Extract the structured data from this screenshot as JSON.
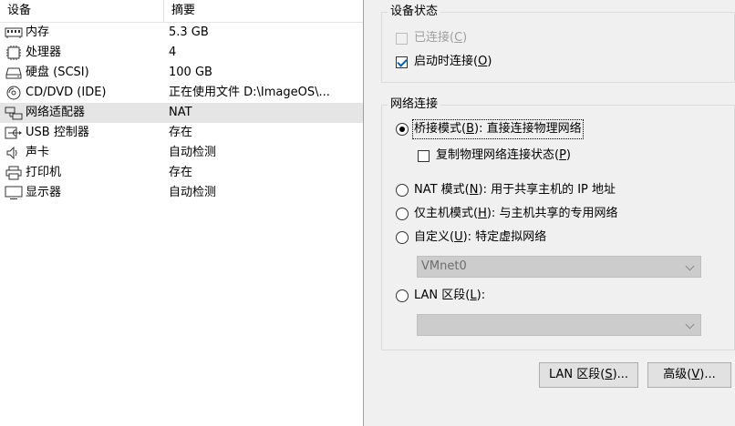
{
  "device_list": {
    "headers": {
      "device": "设备",
      "summary": "摘要"
    },
    "rows": [
      {
        "icon": "memory-icon",
        "name": "内存",
        "summary": "5.3 GB"
      },
      {
        "icon": "processor-icon",
        "name": "处理器",
        "summary": "4"
      },
      {
        "icon": "hard-disk-icon",
        "name": "硬盘 (SCSI)",
        "summary": "100 GB"
      },
      {
        "icon": "cd-dvd-icon",
        "name": "CD/DVD (IDE)",
        "summary": "正在使用文件 D:\\ImageOS\\..."
      },
      {
        "icon": "network-adapter-icon",
        "name": "网络适配器",
        "summary": "NAT"
      },
      {
        "icon": "usb-icon",
        "name": "USB 控制器",
        "summary": "存在"
      },
      {
        "icon": "sound-card-icon",
        "name": "声卡",
        "summary": "自动检测"
      },
      {
        "icon": "printer-icon",
        "name": "打印机",
        "summary": "存在"
      },
      {
        "icon": "display-icon",
        "name": "显示器",
        "summary": "自动检测"
      }
    ]
  },
  "device_status": {
    "title": "设备状态",
    "connected": {
      "label": "已连接(",
      "key": "C",
      "suffix": ")",
      "checked": false,
      "enabled": false
    },
    "connect_at_power_on": {
      "label": "启动时连接(",
      "key": "O",
      "suffix": ")",
      "checked": true,
      "enabled": true
    }
  },
  "network_connection": {
    "title": "网络连接",
    "bridged": {
      "label": "桥接模式(",
      "key": "B",
      "suffix": "): 直接连接物理网络",
      "selected": true
    },
    "replicate": {
      "label": "复制物理网络连接状态(",
      "key": "P",
      "suffix": ")",
      "checked": false
    },
    "nat": {
      "label": "NAT 模式(",
      "key": "N",
      "suffix": "): 用于共享主机的 IP 地址",
      "selected": false
    },
    "host_only": {
      "label": "仅主机模式(",
      "key": "H",
      "suffix": "): 与主机共享的专用网络",
      "selected": false
    },
    "custom": {
      "label": "自定义(",
      "key": "U",
      "suffix": "): 特定虚拟网络",
      "selected": false
    },
    "custom_select_value": "VMnet0",
    "lan_segment": {
      "label": "LAN 区段(",
      "key": "L",
      "suffix": "):",
      "selected": false
    },
    "lan_select_value": ""
  },
  "buttons": {
    "lan_segments": {
      "label": "LAN 区段(",
      "key": "S",
      "suffix": ")..."
    },
    "advanced": {
      "label": "高级(",
      "key": "V",
      "suffix": ")..."
    }
  }
}
